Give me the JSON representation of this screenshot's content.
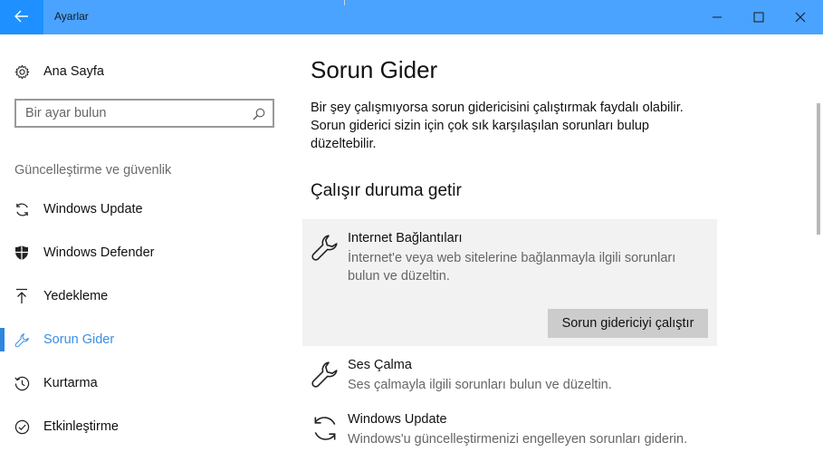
{
  "window": {
    "title": "Ayarlar",
    "back_icon": "back-arrow-icon",
    "controls": [
      "minimize-icon",
      "maximize-icon",
      "close-icon"
    ]
  },
  "sidebar": {
    "home_label": "Ana Sayfa",
    "search_placeholder": "Bir ayar bulun",
    "section_label": "Güncelleştirme ve güvenlik",
    "items": [
      {
        "label": "Windows Update",
        "icon": "refresh-icon"
      },
      {
        "label": "Windows Defender",
        "icon": "shield-icon"
      },
      {
        "label": "Yedekleme",
        "icon": "backup-arrow-icon"
      },
      {
        "label": "Sorun Gider",
        "icon": "wrench-icon",
        "active": true
      },
      {
        "label": "Kurtarma",
        "icon": "history-icon"
      },
      {
        "label": "Etkinleştirme",
        "icon": "check-circle-icon"
      }
    ],
    "accent_color": "#2e86de"
  },
  "main": {
    "title": "Sorun Gider",
    "description": "Bir şey çalışmıyorsa sorun gidericisini çalıştırmak faydalı olabilir. Sorun giderici sizin için çok sık karşılaşılan sorunları bulup düzeltebilir.",
    "section_title": "Çalışır duruma getir",
    "troubleshooters": [
      {
        "name": "Internet Bağlantıları",
        "description": "İnternet'e veya web sitelerine bağlanmayla ilgili sorunları bulun ve düzeltin.",
        "icon": "wrench-icon",
        "selected": true
      },
      {
        "name": "Ses Çalma",
        "description": "Ses çalmayla ilgili sorunları bulun ve düzeltin.",
        "icon": "wrench-icon"
      },
      {
        "name": "Windows Update",
        "description": "Windows'u güncelleştirmenizi engelleyen sorunları giderin.",
        "icon": "refresh-icon"
      }
    ],
    "run_button_label": "Sorun gidericiyi çalıştır"
  },
  "colors": {
    "titlebar": "#4aa3ff",
    "back_button": "#1e90ff",
    "selected_card": "#f2f2f2",
    "button": "#cccccc"
  }
}
